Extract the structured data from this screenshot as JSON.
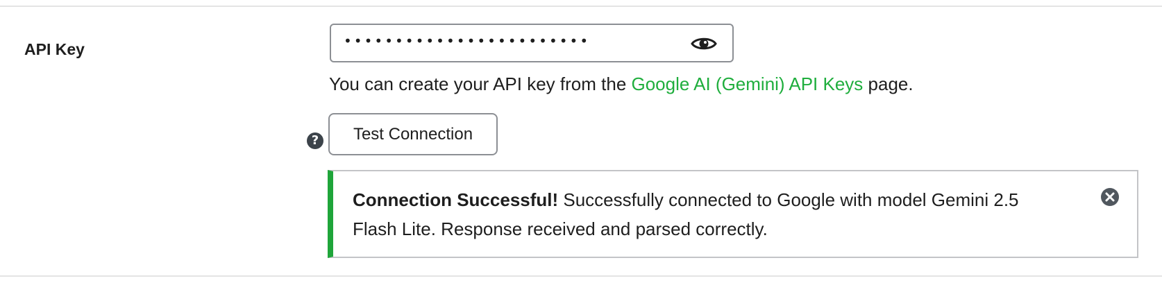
{
  "api_key": {
    "label": "API Key",
    "masked_value": "••••••••••••••••••••••••",
    "visibility_toggle_icon": "eye-icon"
  },
  "help": {
    "prefix": "You can create your API key from the ",
    "link_text": "Google AI (Gemini) API Keys",
    "suffix": " page.",
    "link_color": "#1fae3d"
  },
  "test": {
    "help_icon_glyph": "?",
    "button_label": "Test Connection"
  },
  "notice": {
    "status": "success",
    "accent_color": "#1fa53a",
    "title": "Connection Successful!",
    "message": " Successfully connected to Google with model Gemini 2.5 Flash Lite. Response received and parsed correctly.",
    "dismiss_icon": "close-circle-icon"
  }
}
